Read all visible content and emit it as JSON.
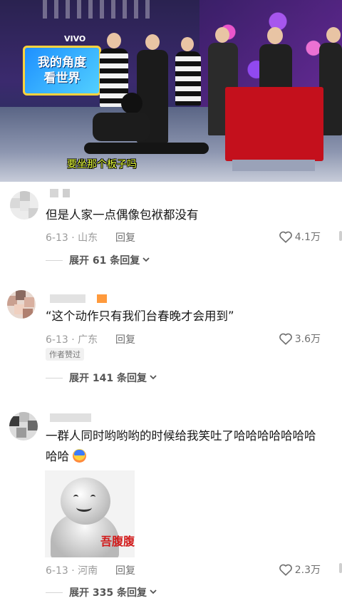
{
  "video": {
    "brand": "VIVO",
    "logo_line1": "我的角度",
    "logo_line2": "看世界",
    "caption": "要坐那个板子吗"
  },
  "comments": [
    {
      "text": "但是人家一点偶像包袱都没有",
      "date_location": "6-13 · 山东",
      "reply_label": "回复",
      "likes": "4.1万",
      "expand_label": "展开 61 条回复"
    },
    {
      "text": "“这个动作只有我们台春晚才会用到”",
      "date_location": "6-13 · 广东",
      "reply_label": "回复",
      "likes": "3.6万",
      "badge": "作者赞过",
      "expand_label": "展开 141 条回复"
    },
    {
      "text_line1": "一群人同时哟哟哟的时候给我笑吐了哈哈哈哈哈哈哈",
      "text_line2": "哈哈",
      "date_location": "6-13 · 河南",
      "reply_label": "回复",
      "likes": "2.3万",
      "sticker_text": "吾腹腹",
      "expand_label": "展开 335 条回复"
    }
  ],
  "icons": {
    "like": "heart-outline-icon",
    "expand": "chevron-down-icon"
  },
  "colors": {
    "text_primary": "#161616",
    "text_meta": "#9a9a9a",
    "caption_yellow": "#e9ff3a"
  }
}
